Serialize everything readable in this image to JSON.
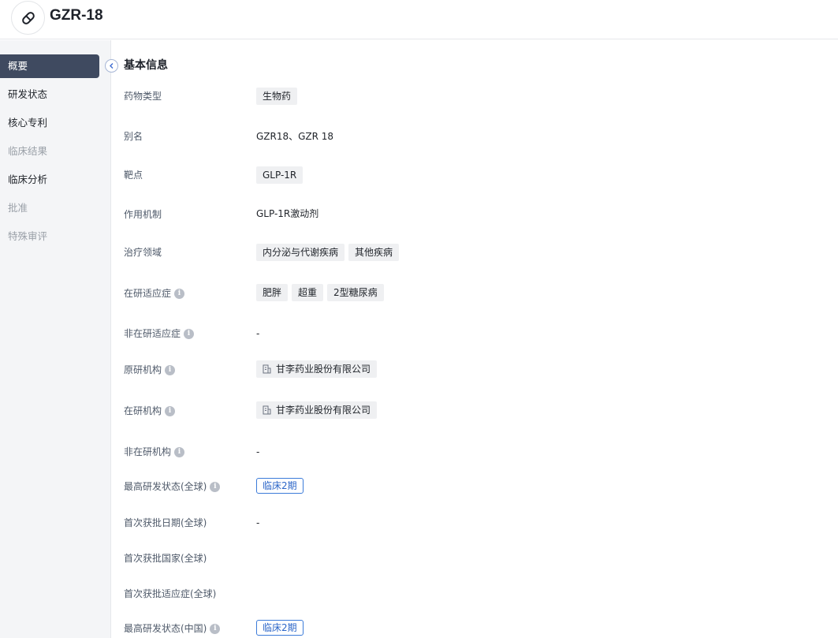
{
  "header": {
    "title": "GZR-18",
    "icon": "pill-icon"
  },
  "sidebar": {
    "items": [
      {
        "label": "概要",
        "state": "active"
      },
      {
        "label": "研发状态",
        "state": "normal"
      },
      {
        "label": "核心专利",
        "state": "normal"
      },
      {
        "label": "临床结果",
        "state": "disabled"
      },
      {
        "label": "临床分析",
        "state": "normal"
      },
      {
        "label": "批准",
        "state": "disabled"
      },
      {
        "label": "特殊审评",
        "state": "disabled"
      }
    ]
  },
  "main": {
    "section_title": "基本信息",
    "rows": {
      "drug_type": {
        "label": "药物类型",
        "tags": [
          "生物药"
        ]
      },
      "alias": {
        "label": "别名",
        "value": "GZR18、GZR 18"
      },
      "target": {
        "label": "靶点",
        "tags": [
          "GLP-1R"
        ]
      },
      "mechanism": {
        "label": "作用机制",
        "value": "GLP-1R激动剂"
      },
      "therapeutic_area": {
        "label": "治疗领域",
        "tags": [
          "内分泌与代谢疾病",
          "其他疾病"
        ]
      },
      "active_indication": {
        "label": "在研适应症",
        "tags": [
          "肥胖",
          "超重",
          "2型糖尿病"
        ]
      },
      "inactive_indication": {
        "label": "非在研适应症",
        "value": "-"
      },
      "originator": {
        "label": "原研机构",
        "org": "甘李药业股份有限公司"
      },
      "active_org": {
        "label": "在研机构",
        "org": "甘李药业股份有限公司"
      },
      "inactive_org": {
        "label": "非在研机构",
        "value": "-"
      },
      "highest_status_global": {
        "label": "最高研发状态(全球)",
        "status": "临床2期"
      },
      "first_approval_date": {
        "label": "首次获批日期(全球)",
        "value": "-"
      },
      "first_approval_country": {
        "label": "首次获批国家(全球)",
        "value": ""
      },
      "first_approval_indication": {
        "label": "首次获批适应症(全球)",
        "value": ""
      },
      "highest_status_china": {
        "label": "最高研发状态(中国)",
        "status": "临床2期"
      }
    }
  },
  "colors": {
    "active_nav_bg": "#3f4a60",
    "status_blue": "#2c66c8",
    "tag_bg": "#eff0f2"
  }
}
